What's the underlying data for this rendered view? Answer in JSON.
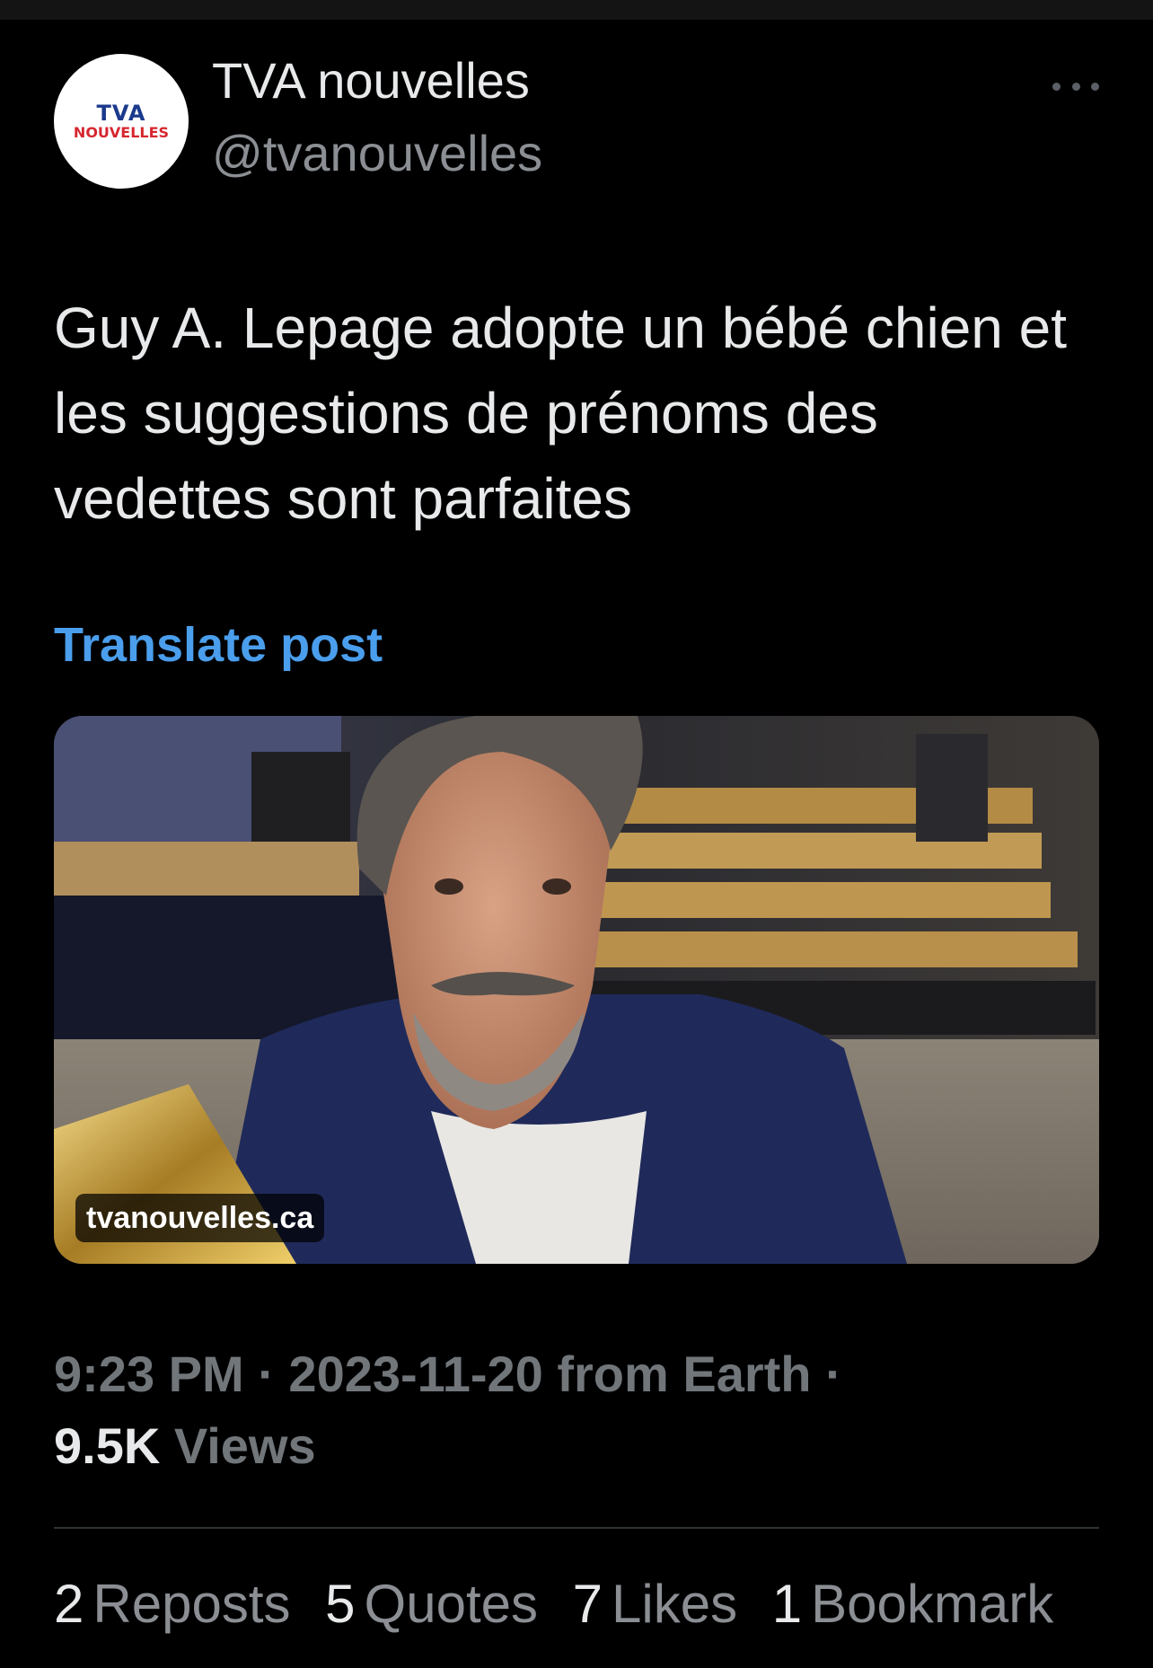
{
  "account": {
    "display_name": "TVA nouvelles",
    "handle": "@tvanouvelles",
    "avatar_logo_top": "TVA",
    "avatar_logo_bottom": "NOUVELLES"
  },
  "post": {
    "text": "Guy A. Lepage adopte un bébé chien et les suggestions de prénoms des vedettes sont parfaites",
    "translate_label": "Translate post",
    "media_domain": "tvanouvelles.ca"
  },
  "meta": {
    "time": "9:23 PM",
    "separator": "·",
    "date": "2023-11-20",
    "source": "from Earth",
    "views_count": "9.5K",
    "views_label": "Views"
  },
  "stats": {
    "reposts_count": "2",
    "reposts_label": "Reposts",
    "quotes_count": "5",
    "quotes_label": "Quotes",
    "likes_count": "7",
    "likes_label": "Likes",
    "bookmarks_count": "1",
    "bookmarks_label": "Bookmark"
  },
  "colors": {
    "background": "#000000",
    "text_primary": "#e7e9ea",
    "text_secondary": "#71767b",
    "link_blue": "#4a9eec",
    "divider": "#2f3336"
  },
  "icons": {
    "more": "more-horizontal-icon"
  }
}
